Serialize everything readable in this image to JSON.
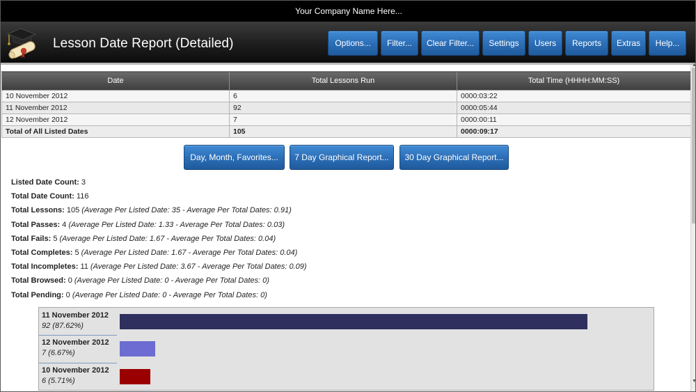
{
  "company_bar": {
    "text": "Your Company Name Here..."
  },
  "header": {
    "title": "Lesson Date Report (Detailed)",
    "nav": [
      "Options...",
      "Filter...",
      "Clear Filter...",
      "Settings",
      "Users",
      "Reports",
      "Extras",
      "Help..."
    ]
  },
  "report_table": {
    "columns": [
      "Date",
      "Total Lessons Run",
      "Total Time (HHHH:MM:SS)"
    ],
    "rows": [
      [
        "10 November 2012",
        "6",
        "0000:03:22"
      ],
      [
        "11 November 2012",
        "92",
        "0000:05:44"
      ],
      [
        "12 November 2012",
        "7",
        "0000:00:11"
      ]
    ],
    "total": [
      "Total of All Listed Dates",
      "105",
      "0000:09:17"
    ]
  },
  "actions": [
    "Day, Month, Favorites...",
    "7 Day Graphical Report...",
    "30 Day Graphical Report..."
  ],
  "stats": [
    {
      "label": "Listed Date Count:",
      "value": "3",
      "note": ""
    },
    {
      "label": "Total Date Count:",
      "value": "116",
      "note": ""
    },
    {
      "label": "Total Lessons:",
      "value": "105",
      "note": "(Average Per Listed Date: 35 - Average Per Total Dates: 0.91)"
    },
    {
      "label": "Total Passes:",
      "value": "4",
      "note": "(Average Per Listed Date: 1.33 - Average Per Total Dates: 0.03)"
    },
    {
      "label": "Total Fails:",
      "value": "5",
      "note": "(Average Per Listed Date: 1.67 - Average Per Total Dates: 0.04)"
    },
    {
      "label": "Total Completes:",
      "value": "5",
      "note": "(Average Per Listed Date: 1.67 - Average Per Total Dates: 0.04)"
    },
    {
      "label": "Total Incompletes:",
      "value": "11",
      "note": "(Average Per Listed Date: 3.67 - Average Per Total Dates: 0.09)"
    },
    {
      "label": "Total Browsed:",
      "value": "0",
      "note": "(Average Per Listed Date: 0 - Average Per Total Dates: 0)"
    },
    {
      "label": "Total Pending:",
      "value": "0",
      "note": "(Average Per Listed Date: 0 - Average Per Total Dates: 0)"
    }
  ],
  "lesson_bars": [
    {
      "date": "11 November 2012",
      "pct_label": "92 (87.62%)",
      "value": 92,
      "color": "#30305e"
    },
    {
      "date": "12 November 2012",
      "pct_label": "7 (6.67%)",
      "value": 7,
      "color": "#6c6cd2"
    },
    {
      "date": "10 November 2012",
      "pct_label": "6 (5.71%)",
      "value": 6,
      "color": "#9b0000"
    }
  ],
  "chart_data": {
    "type": "bar",
    "orientation": "horizontal",
    "categories": [
      "11 November 2012",
      "12 November 2012",
      "10 November 2012"
    ],
    "values": [
      92,
      7,
      6
    ],
    "data_labels": [
      "92 (87.62%)",
      "7 (6.67%)",
      "6 (5.71%)"
    ],
    "colors": [
      "#30305e",
      "#6c6cd2",
      "#9b0000"
    ],
    "grid": false
  }
}
